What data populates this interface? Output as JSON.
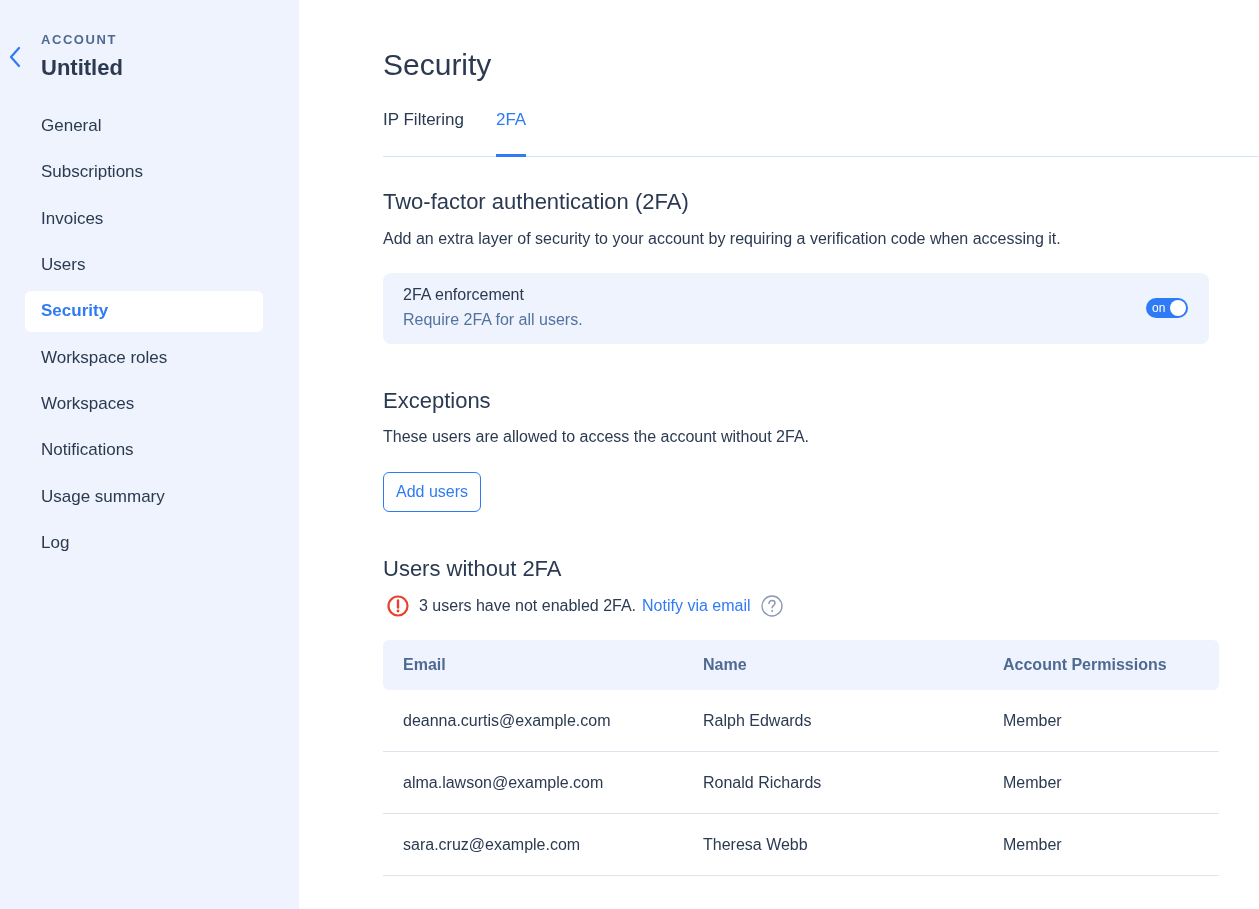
{
  "sidebar": {
    "section_label": "ACCOUNT",
    "account_name": "Untitled",
    "items": [
      {
        "label": "General",
        "selected": false
      },
      {
        "label": "Subscriptions",
        "selected": false
      },
      {
        "label": "Invoices",
        "selected": false
      },
      {
        "label": "Users",
        "selected": false
      },
      {
        "label": "Security",
        "selected": true
      },
      {
        "label": "Workspace roles",
        "selected": false
      },
      {
        "label": "Workspaces",
        "selected": false
      },
      {
        "label": "Notifications",
        "selected": false
      },
      {
        "label": "Usage summary",
        "selected": false
      },
      {
        "label": "Log",
        "selected": false
      }
    ]
  },
  "page": {
    "title": "Security",
    "tabs": [
      {
        "label": "IP Filtering",
        "selected": false
      },
      {
        "label": "2FA",
        "selected": true
      }
    ],
    "two_factor": {
      "heading": "Two-factor authentication (2FA)",
      "description": "Add an extra layer of security to your account by requiring a verification code when accessing it.",
      "enforcement": {
        "title": "2FA enforcement",
        "subtitle": "Require 2FA for all users.",
        "on": true,
        "toggle_label": "on"
      }
    },
    "exceptions": {
      "heading": "Exceptions",
      "description": "These users are allowed to access the account without 2FA.",
      "button": "Add users"
    },
    "users_without_2fa": {
      "heading": "Users without 2FA",
      "alert": {
        "message": "3 users have not enabled 2FA.",
        "link": "Notify via email"
      },
      "table": {
        "columns": [
          "Email",
          "Name",
          "Account Permissions"
        ],
        "rows": [
          [
            "deanna.curtis@example.com",
            "Ralph Edwards",
            "Member"
          ],
          [
            "alma.lawson@example.com",
            "Ronald Richards",
            "Member"
          ],
          [
            "sara.cruz@example.com",
            "Theresa Webb",
            "Member"
          ]
        ]
      }
    }
  }
}
